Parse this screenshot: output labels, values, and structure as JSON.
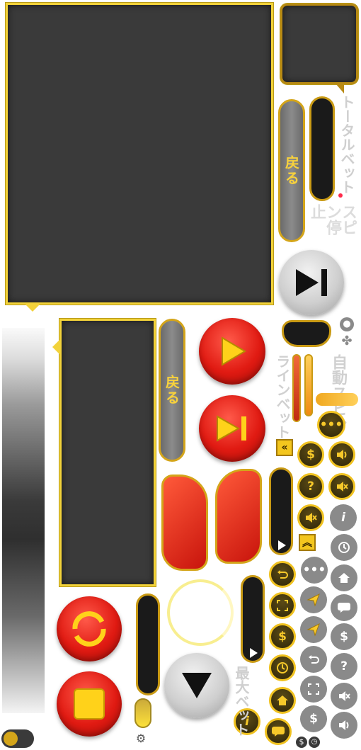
{
  "labels": {
    "total_bet": "トータルベット",
    "spin_stop": "スピン停止",
    "auto_spin": "自動スピン",
    "line_bet": "ラインベット",
    "max_bet": "最大ベット",
    "back_top": "戻る",
    "back_mid": "戻る"
  },
  "icons": {
    "more": "•••",
    "help": "?",
    "info": "i",
    "coin": "$",
    "chevron_double_left": "«",
    "chevron_double_up": "︽"
  },
  "colors": {
    "gold": "#f2d23a",
    "panel": "#3a3a3a",
    "red": "#e01a12",
    "gray_button": "#8a8a8a"
  }
}
